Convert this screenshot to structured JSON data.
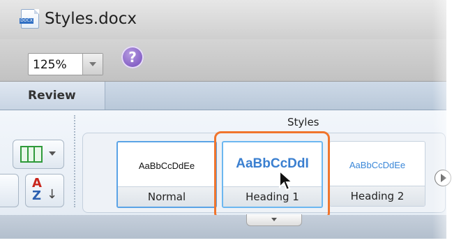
{
  "window": {
    "title": "Styles.docx",
    "doc_icon_label": "DOCX"
  },
  "toolbar": {
    "zoom_value": "125%",
    "help_glyph": "?"
  },
  "tabs": {
    "active_label": "Review"
  },
  "ribbon": {
    "group_label": "Styles",
    "styles": [
      {
        "name": "Normal",
        "sample": "AaBbCcDdEe"
      },
      {
        "name": "Heading 1",
        "sample": "AaBbCcDdI"
      },
      {
        "name": "Heading 2",
        "sample": "AaBbCcDdEe"
      }
    ],
    "sort_glyphs": {
      "a": "A",
      "z": "Z",
      "arrow": "↓"
    }
  },
  "colors": {
    "highlight": "#f0752d",
    "selected_border": "#5aa3e6",
    "heading_text": "#3a7fd0",
    "help_icon": "#6d43b8"
  },
  "icons": [
    "document-icon",
    "zoom-dropdown-icon",
    "help-icon",
    "columns-icon",
    "sort-icon",
    "next-styles-icon",
    "expand-gallery-icon",
    "mouse-pointer-icon"
  ]
}
